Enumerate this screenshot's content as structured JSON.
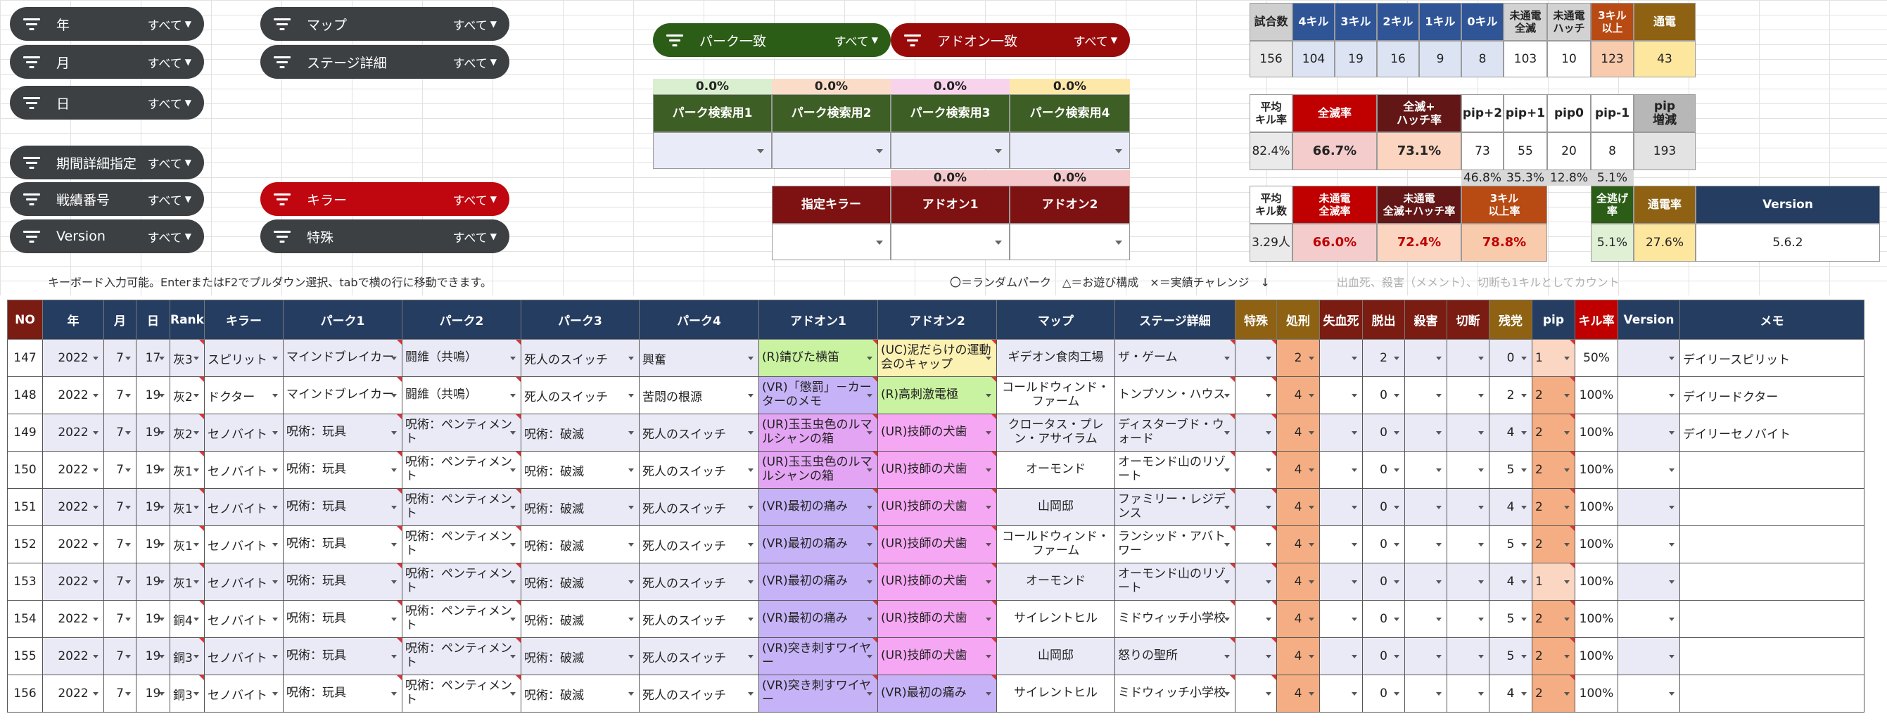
{
  "filters": {
    "year": {
      "label": "年",
      "value": "すべて"
    },
    "month": {
      "label": "月",
      "value": "すべて"
    },
    "day": {
      "label": "日",
      "value": "すべて"
    },
    "period": {
      "label": "期間詳細指定",
      "value": "すべて"
    },
    "record_no": {
      "label": "戦績番号",
      "value": "すべて"
    },
    "version": {
      "label": "Version",
      "value": "すべて"
    },
    "map": {
      "label": "マップ",
      "value": "すべて"
    },
    "stage": {
      "label": "ステージ詳細",
      "value": "すべて"
    },
    "killer": {
      "label": "キラー",
      "value": "すべて"
    },
    "special": {
      "label": "特殊",
      "value": "すべて"
    },
    "perk_match": {
      "label": "パーク一致",
      "value": "すべて"
    },
    "addon_match": {
      "label": "アドオン一致",
      "value": "すべて"
    }
  },
  "perk_search": {
    "percents": [
      "0.0%",
      "0.0%",
      "0.0%",
      "0.0%"
    ],
    "labels": [
      "パーク検索用1",
      "パーク検索用2",
      "パーク検索用3",
      "パーク検索用4"
    ],
    "sub_percents": [
      "0.0%",
      "0.0%"
    ]
  },
  "killer_search": {
    "labels": [
      "指定キラー",
      "アドオン1",
      "アドオン2"
    ]
  },
  "stats1": {
    "headers": [
      "試合数",
      "4キル",
      "3キル",
      "2キル",
      "1キル",
      "0キル",
      "未通電\n全滅",
      "未通電\nハッチ",
      "3キル\n以上",
      "通電"
    ],
    "values": [
      "156",
      "104",
      "19",
      "16",
      "9",
      "8",
      "103",
      "10",
      "123",
      "43"
    ]
  },
  "stats2": {
    "headers": [
      "平均\nキル率",
      "全滅率",
      "全滅+\nハッチ率",
      "pip+2",
      "pip+1",
      "pip0",
      "pip-1",
      "pip\n増減"
    ],
    "values": [
      "82.4%",
      "66.7%",
      "73.1%",
      "73",
      "55",
      "20",
      "8",
      "193"
    ],
    "pip_pcts": [
      "46.8%",
      "35.3%",
      "12.8%",
      "5.1%"
    ]
  },
  "stats3": {
    "headers": [
      "平均\nキル数",
      "未通電\n全滅率",
      "未通電\n全滅+ハッチ率",
      "3キル\n以上率",
      "全逃げ\n率",
      "通電率",
      "Version"
    ],
    "values": [
      "3.29人",
      "66.0%",
      "72.4%",
      "78.8%",
      "5.1%",
      "27.6%",
      "5.6.2"
    ]
  },
  "notes": {
    "keyboard": "キーボード入力可能。EnterまたはF2でプルダウン選択、tabで横の行に移動できます。",
    "legend": "〇＝ランダムパーク　△＝お遊び構成　×＝実績チャレンジ　↓",
    "count_note": "出血死、殺害（メメント）、切断も1キルとしてカウント"
  },
  "table": {
    "columns": [
      "NO",
      "年",
      "月",
      "日",
      "Rank",
      "キラー",
      "パーク1",
      "パーク2",
      "パーク3",
      "パーク4",
      "アドオン1",
      "アドオン2",
      "マップ",
      "ステージ詳細",
      "特殊",
      "処刑",
      "失血死",
      "脱出",
      "殺害",
      "切断",
      "残党",
      "pip",
      "キル率",
      "Version",
      "メモ"
    ],
    "rows": [
      {
        "no": "147",
        "year": "2022",
        "month": "7",
        "day": "17",
        "rank": "灰3",
        "killer": "スピリット",
        "perk1": "マインドブレイカー",
        "perk2": "闘維（共鳴）",
        "perk3": "死人のスイッチ",
        "perk4": "興奮",
        "addon1": "(R)錆びた横笛",
        "addon2": "(UC)泥だらけの運動会のキャップ",
        "map": "ギデオン食肉工場",
        "stage": "ザ・ゲーム",
        "special": "",
        "exec": "2",
        "bleed": "",
        "escape": "2",
        "kill": "",
        "dc": "",
        "remain": "0",
        "pip": "1",
        "killrate": "50%",
        "version": "",
        "memo": "デイリースピリット"
      },
      {
        "no": "148",
        "year": "2022",
        "month": "7",
        "day": "19",
        "rank": "灰2",
        "killer": "ドクター",
        "perk1": "マインドブレイカー",
        "perk2": "闘維（共鳴）",
        "perk3": "死人のスイッチ",
        "perk4": "苦悶の根源",
        "addon1": "(VR)「懲罰」－カーターのメモ",
        "addon2": "(R)高刺激電極",
        "map": "コールドウィンド・ファーム",
        "stage": "トンプソン・ハウス",
        "special": "",
        "exec": "4",
        "bleed": "",
        "escape": "0",
        "kill": "",
        "dc": "",
        "remain": "2",
        "pip": "2",
        "killrate": "100%",
        "version": "",
        "memo": "デイリードクター"
      },
      {
        "no": "149",
        "year": "2022",
        "month": "7",
        "day": "19",
        "rank": "灰2",
        "killer": "セノバイト",
        "perk1": "呪術：玩具",
        "perk2": "呪術：ペンティメント",
        "perk3": "呪術：破滅",
        "perk4": "死人のスイッチ",
        "addon1": "(UR)玉玉虫色のルマルシャンの箱",
        "addon2": "(UR)技師の犬歯",
        "map": "クロータス・プレン・アサイラム",
        "stage": "ディスターブド・ウォード",
        "special": "",
        "exec": "4",
        "bleed": "",
        "escape": "0",
        "kill": "",
        "dc": "",
        "remain": "4",
        "pip": "2",
        "killrate": "100%",
        "version": "",
        "memo": "デイリーセノバイト"
      },
      {
        "no": "150",
        "year": "2022",
        "month": "7",
        "day": "19",
        "rank": "灰1",
        "killer": "セノバイト",
        "perk1": "呪術：玩具",
        "perk2": "呪術：ペンティメント",
        "perk3": "呪術：破滅",
        "perk4": "死人のスイッチ",
        "addon1": "(UR)玉玉虫色のルマルシャンの箱",
        "addon2": "(UR)技師の犬歯",
        "map": "オーモンド",
        "stage": "オーモンド山のリゾート",
        "special": "",
        "exec": "4",
        "bleed": "",
        "escape": "0",
        "kill": "",
        "dc": "",
        "remain": "5",
        "pip": "2",
        "killrate": "100%",
        "version": "",
        "memo": ""
      },
      {
        "no": "151",
        "year": "2022",
        "month": "7",
        "day": "19",
        "rank": "灰1",
        "killer": "セノバイト",
        "perk1": "呪術：玩具",
        "perk2": "呪術：ペンティメント",
        "perk3": "呪術：破滅",
        "perk4": "死人のスイッチ",
        "addon1": "(VR)最初の痛み",
        "addon2": "(UR)技師の犬歯",
        "map": "山岡邸",
        "stage": "ファミリー・レジデンス",
        "special": "",
        "exec": "4",
        "bleed": "",
        "escape": "0",
        "kill": "",
        "dc": "",
        "remain": "4",
        "pip": "2",
        "killrate": "100%",
        "version": "",
        "memo": ""
      },
      {
        "no": "152",
        "year": "2022",
        "month": "7",
        "day": "19",
        "rank": "灰1",
        "killer": "セノバイト",
        "perk1": "呪術：玩具",
        "perk2": "呪術：ペンティメント",
        "perk3": "呪術：破滅",
        "perk4": "死人のスイッチ",
        "addon1": "(VR)最初の痛み",
        "addon2": "(UR)技師の犬歯",
        "map": "コールドウィンド・ファーム",
        "stage": "ランシッド・アバトワー",
        "special": "",
        "exec": "4",
        "bleed": "",
        "escape": "0",
        "kill": "",
        "dc": "",
        "remain": "5",
        "pip": "2",
        "killrate": "100%",
        "version": "",
        "memo": ""
      },
      {
        "no": "153",
        "year": "2022",
        "month": "7",
        "day": "19",
        "rank": "灰1",
        "killer": "セノバイト",
        "perk1": "呪術：玩具",
        "perk2": "呪術：ペンティメント",
        "perk3": "呪術：破滅",
        "perk4": "死人のスイッチ",
        "addon1": "(VR)最初の痛み",
        "addon2": "(UR)技師の犬歯",
        "map": "オーモンド",
        "stage": "オーモンド山のリゾート",
        "special": "",
        "exec": "4",
        "bleed": "",
        "escape": "0",
        "kill": "",
        "dc": "",
        "remain": "4",
        "pip": "1",
        "killrate": "100%",
        "version": "",
        "memo": ""
      },
      {
        "no": "154",
        "year": "2022",
        "month": "7",
        "day": "19",
        "rank": "銅4",
        "killer": "セノバイト",
        "perk1": "呪術：玩具",
        "perk2": "呪術：ペンティメント",
        "perk3": "呪術：破滅",
        "perk4": "死人のスイッチ",
        "addon1": "(VR)最初の痛み",
        "addon2": "(UR)技師の犬歯",
        "map": "サイレントヒル",
        "stage": "ミドウィッチ小学校",
        "special": "",
        "exec": "4",
        "bleed": "",
        "escape": "0",
        "kill": "",
        "dc": "",
        "remain": "5",
        "pip": "2",
        "killrate": "100%",
        "version": "",
        "memo": ""
      },
      {
        "no": "155",
        "year": "2022",
        "month": "7",
        "day": "19",
        "rank": "銅3",
        "killer": "セノバイト",
        "perk1": "呪術：玩具",
        "perk2": "呪術：ペンティメント",
        "perk3": "呪術：破滅",
        "perk4": "死人のスイッチ",
        "addon1": "(VR)突き刺すワイヤー",
        "addon2": "(UR)技師の犬歯",
        "map": "山岡邸",
        "stage": "怒りの聖所",
        "special": "",
        "exec": "4",
        "bleed": "",
        "escape": "0",
        "kill": "",
        "dc": "",
        "remain": "5",
        "pip": "2",
        "killrate": "100%",
        "version": "",
        "memo": ""
      },
      {
        "no": "156",
        "year": "2022",
        "month": "7",
        "day": "19",
        "rank": "銅3",
        "killer": "セノバイト",
        "perk1": "呪術：玩具",
        "perk2": "呪術：ペンティメント",
        "perk3": "呪術：破滅",
        "perk4": "死人のスイッチ",
        "addon1": "(VR)突き刺すワイヤー",
        "addon2": "(VR)最初の痛み",
        "map": "サイレントヒル",
        "stage": "ミドウィッチ小学校",
        "special": "",
        "exec": "4",
        "bleed": "",
        "escape": "0",
        "kill": "",
        "dc": "",
        "remain": "4",
        "pip": "2",
        "killrate": "100%",
        "version": "",
        "memo": ""
      }
    ]
  },
  "colors": {
    "header_navy": "#253d61",
    "header_gold": "#8e6212",
    "header_red": "#c00000",
    "chip_dark": "#3c4043",
    "chip_red": "#c0060f",
    "chip_green": "#2c5d17",
    "orange_cell": "#f5ae83"
  }
}
